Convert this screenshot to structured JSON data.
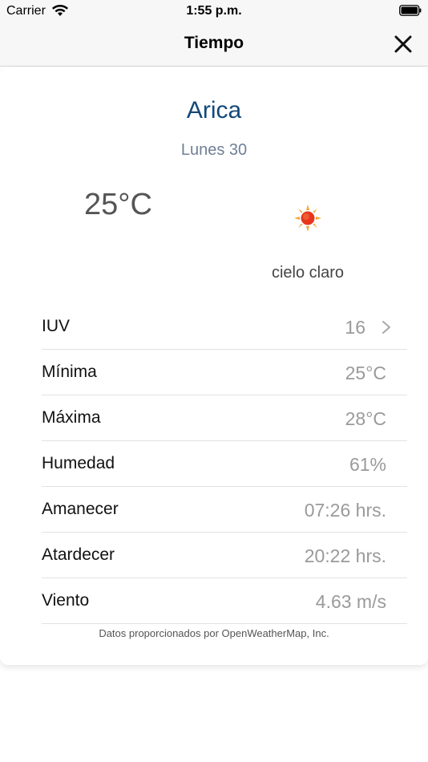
{
  "status_bar": {
    "carrier": "Carrier",
    "time": "1:55 p.m."
  },
  "nav": {
    "title": "Tiempo"
  },
  "weather": {
    "city": "Arica",
    "date": "Lunes 30",
    "temperature": "25°C",
    "condition": "cielo claro",
    "icon": "sun-icon"
  },
  "details": [
    {
      "label": "IUV",
      "value": "16"
    },
    {
      "label": "Mínima",
      "value": "25°C"
    },
    {
      "label": "Máxima",
      "value": "28°C"
    },
    {
      "label": "Humedad",
      "value": "61%"
    },
    {
      "label": "Amanecer",
      "value": "07:26 hrs."
    },
    {
      "label": "Atardecer",
      "value": "20:22 hrs."
    },
    {
      "label": "Viento",
      "value": "4.63 m/s"
    }
  ],
  "footer": {
    "attribution": "Datos proporcionados por OpenWeatherMap, Inc."
  },
  "colors": {
    "city": "#12497a",
    "date": "#6f8096",
    "value": "#9a9a9a"
  }
}
